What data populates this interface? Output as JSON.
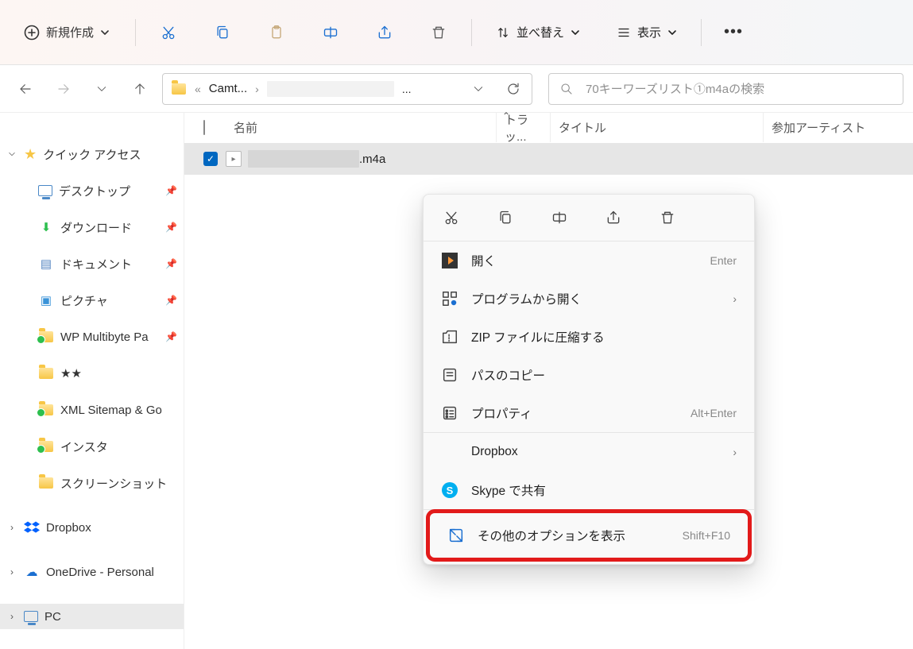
{
  "toolbar": {
    "new_label": "新規作成",
    "sort_label": "並べ替え",
    "view_label": "表示"
  },
  "address": {
    "crumb1": "Camt...",
    "ellipsis": "..."
  },
  "search": {
    "placeholder": "70キーワーズリスト①m4aの検索"
  },
  "columns": {
    "name": "名前",
    "track": "トラッ...",
    "title": "タイトル",
    "artist": "参加アーティスト"
  },
  "file": {
    "name_suffix": ".m4a"
  },
  "sidebar": {
    "quick_access": "クイック アクセス",
    "items": [
      {
        "label": "デスクトップ"
      },
      {
        "label": "ダウンロード"
      },
      {
        "label": "ドキュメント"
      },
      {
        "label": "ピクチャ"
      },
      {
        "label": "WP Multibyte Pa"
      },
      {
        "label": "★★"
      },
      {
        "label": "XML Sitemap & Go"
      },
      {
        "label": "インスタ"
      },
      {
        "label": "スクリーンショット"
      }
    ],
    "dropbox": "Dropbox",
    "onedrive": "OneDrive - Personal",
    "pc": "PC"
  },
  "ctx": {
    "open": "開く",
    "open_shortcut": "Enter",
    "open_with": "プログラムから開く",
    "zip": "ZIP ファイルに圧縮する",
    "copy_path": "パスのコピー",
    "properties": "プロパティ",
    "properties_shortcut": "Alt+Enter",
    "dropbox": "Dropbox",
    "skype": "Skype で共有",
    "more": "その他のオプションを表示",
    "more_shortcut": "Shift+F10"
  }
}
